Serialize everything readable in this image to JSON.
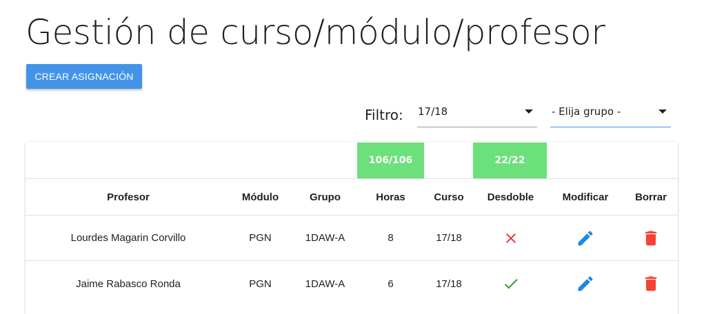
{
  "page": {
    "title": "Gestión de curso/módulo/profesor"
  },
  "toolbar": {
    "create_label": "Crear asignación"
  },
  "filter": {
    "label": "Filtro:",
    "year_value": "17/18",
    "group_value": "- Elija grupo -"
  },
  "summary": {
    "hours_badge": "106/106",
    "split_badge": "22/22"
  },
  "table": {
    "headers": {
      "profesor": "Profesor",
      "modulo": "Módulo",
      "grupo": "Grupo",
      "horas": "Horas",
      "curso": "Curso",
      "desdoble": "Desdoble",
      "modificar": "Modificar",
      "borrar": "Borrar"
    },
    "rows": [
      {
        "profesor": "Lourdes Magarin Corvillo",
        "modulo": "PGN",
        "grupo": "1DAW-A",
        "horas": "8",
        "curso": "17/18",
        "desdoble": false
      },
      {
        "profesor": "Jaime Rabasco Ronda",
        "modulo": "PGN",
        "grupo": "1DAW-A",
        "horas": "6",
        "curso": "17/18",
        "desdoble": true
      }
    ]
  },
  "colors": {
    "primary": "#4394e8",
    "badge_green": "#6ce07a",
    "edit_blue": "#1e88e5",
    "delete_red": "#f44336",
    "check_green": "#43a047",
    "cross_red": "#e53935"
  },
  "icons": {
    "edit": "pencil-icon",
    "delete": "trash-icon",
    "yes": "check-icon",
    "no": "close-icon",
    "dropdown": "caret-down-icon"
  }
}
